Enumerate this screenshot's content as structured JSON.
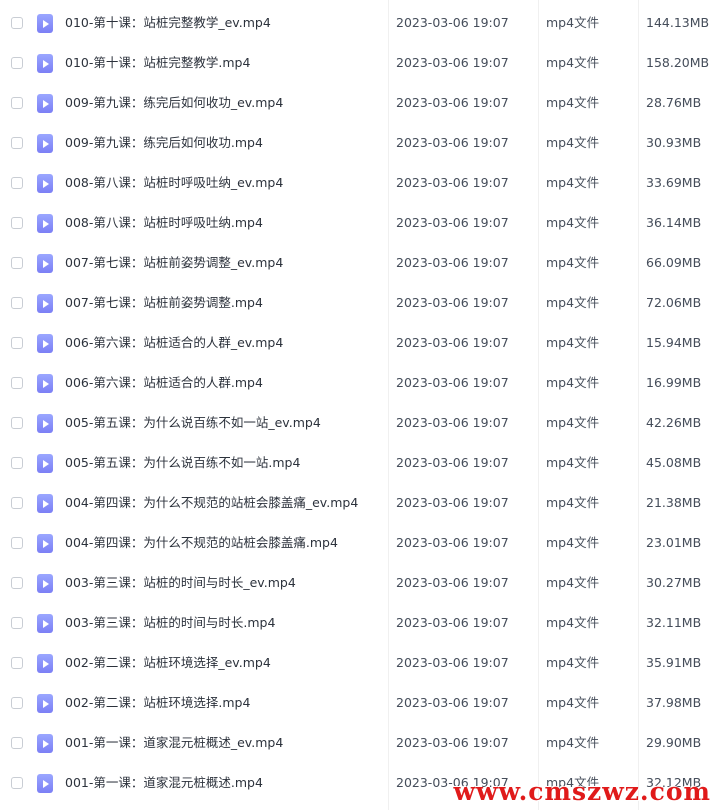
{
  "files": [
    {
      "name": "010-第十课：站桩完整教学_ev.mp4",
      "date": "2023-03-06 19:07",
      "type": "mp4文件",
      "size": "144.13MB"
    },
    {
      "name": "010-第十课：站桩完整教学.mp4",
      "date": "2023-03-06 19:07",
      "type": "mp4文件",
      "size": "158.20MB"
    },
    {
      "name": "009-第九课：练完后如何收功_ev.mp4",
      "date": "2023-03-06 19:07",
      "type": "mp4文件",
      "size": "28.76MB"
    },
    {
      "name": "009-第九课：练完后如何收功.mp4",
      "date": "2023-03-06 19:07",
      "type": "mp4文件",
      "size": "30.93MB"
    },
    {
      "name": "008-第八课：站桩时呼吸吐纳_ev.mp4",
      "date": "2023-03-06 19:07",
      "type": "mp4文件",
      "size": "33.69MB"
    },
    {
      "name": "008-第八课：站桩时呼吸吐纳.mp4",
      "date": "2023-03-06 19:07",
      "type": "mp4文件",
      "size": "36.14MB"
    },
    {
      "name": "007-第七课：站桩前姿势调整_ev.mp4",
      "date": "2023-03-06 19:07",
      "type": "mp4文件",
      "size": "66.09MB"
    },
    {
      "name": "007-第七课：站桩前姿势调整.mp4",
      "date": "2023-03-06 19:07",
      "type": "mp4文件",
      "size": "72.06MB"
    },
    {
      "name": "006-第六课：站桩适合的人群_ev.mp4",
      "date": "2023-03-06 19:07",
      "type": "mp4文件",
      "size": "15.94MB"
    },
    {
      "name": "006-第六课：站桩适合的人群.mp4",
      "date": "2023-03-06 19:07",
      "type": "mp4文件",
      "size": "16.99MB"
    },
    {
      "name": "005-第五课：为什么说百练不如一站_ev.mp4",
      "date": "2023-03-06 19:07",
      "type": "mp4文件",
      "size": "42.26MB"
    },
    {
      "name": "005-第五课：为什么说百练不如一站.mp4",
      "date": "2023-03-06 19:07",
      "type": "mp4文件",
      "size": "45.08MB"
    },
    {
      "name": "004-第四课：为什么不规范的站桩会膝盖痛_ev.mp4",
      "date": "2023-03-06 19:07",
      "type": "mp4文件",
      "size": "21.38MB"
    },
    {
      "name": "004-第四课：为什么不规范的站桩会膝盖痛.mp4",
      "date": "2023-03-06 19:07",
      "type": "mp4文件",
      "size": "23.01MB"
    },
    {
      "name": "003-第三课：站桩的时间与时长_ev.mp4",
      "date": "2023-03-06 19:07",
      "type": "mp4文件",
      "size": "30.27MB"
    },
    {
      "name": "003-第三课：站桩的时间与时长.mp4",
      "date": "2023-03-06 19:07",
      "type": "mp4文件",
      "size": "32.11MB"
    },
    {
      "name": "002-第二课：站桩环境选择_ev.mp4",
      "date": "2023-03-06 19:07",
      "type": "mp4文件",
      "size": "35.91MB"
    },
    {
      "name": "002-第二课：站桩环境选择.mp4",
      "date": "2023-03-06 19:07",
      "type": "mp4文件",
      "size": "37.98MB"
    },
    {
      "name": "001-第一课：道家混元桩概述_ev.mp4",
      "date": "2023-03-06 19:07",
      "type": "mp4文件",
      "size": "29.90MB"
    },
    {
      "name": "001-第一课：道家混元桩概述.mp4",
      "date": "2023-03-06 19:07",
      "type": "mp4文件",
      "size": "32.12MB"
    }
  ],
  "file_icon": "video-file-icon",
  "watermark": "www.cmszwz.com",
  "colors": {
    "icon_accent": "#7b7ff5",
    "watermark": "#e01a1a"
  }
}
